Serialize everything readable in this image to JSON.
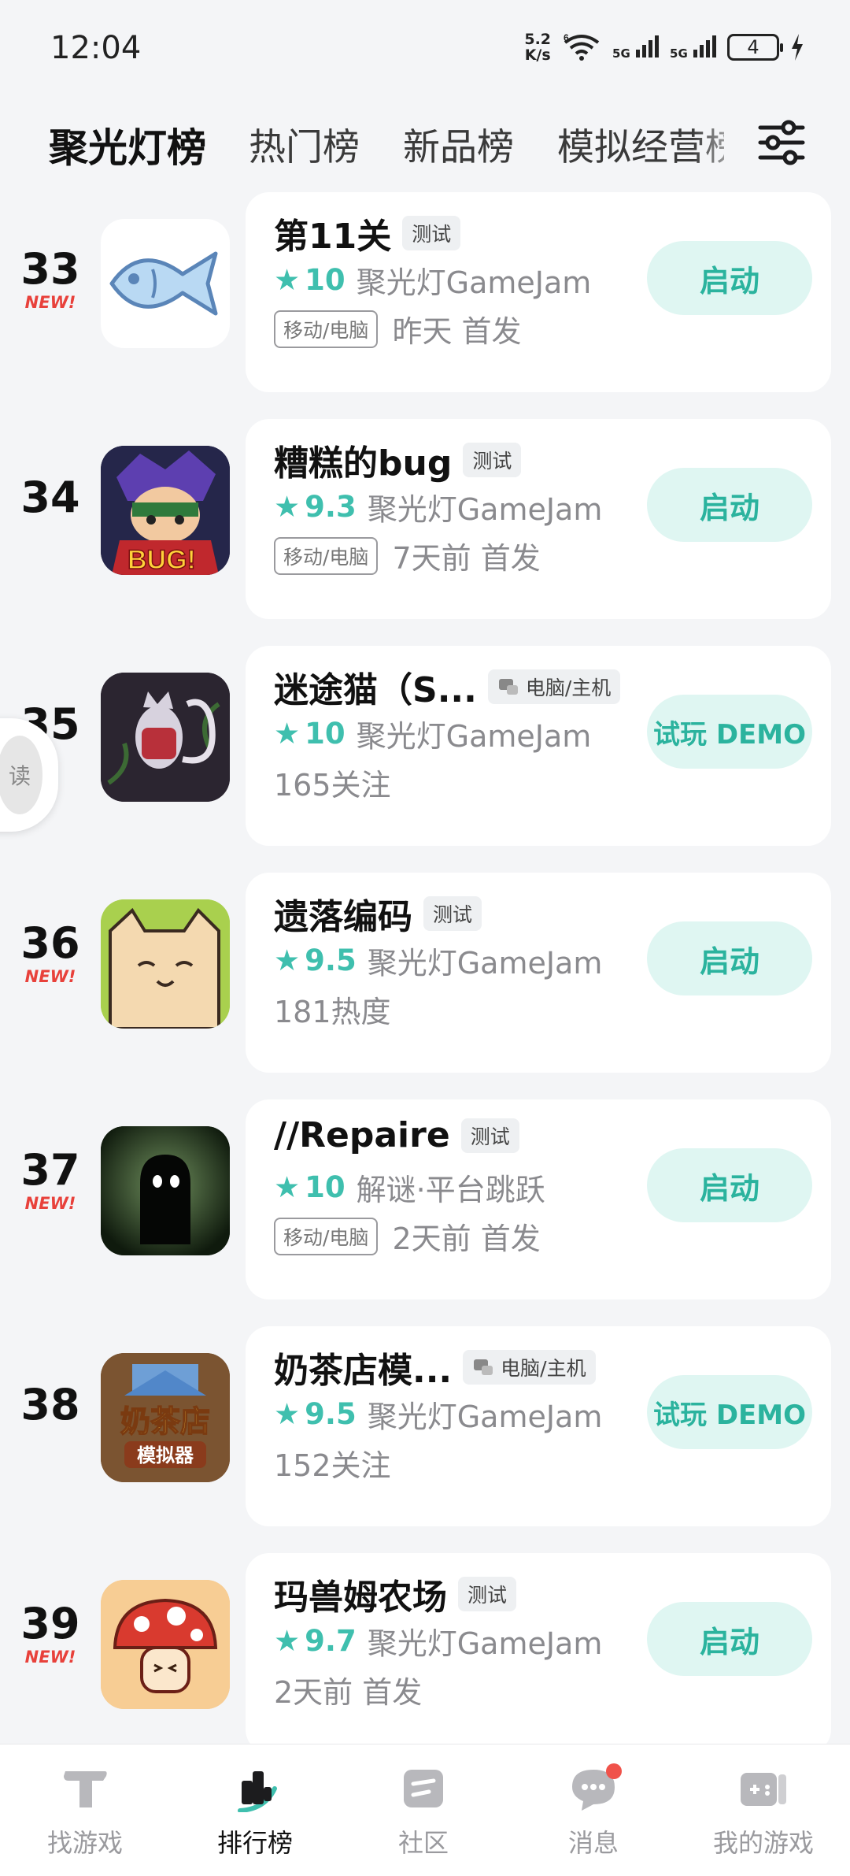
{
  "status_bar": {
    "time": "12:04",
    "net_speed_value": "5.2",
    "net_speed_unit": "K/s",
    "wifi_label": "6",
    "sim1": "5G",
    "sim2": "5G",
    "battery": "4"
  },
  "tabs": [
    {
      "label": "聚光灯榜",
      "active": true
    },
    {
      "label": "热门榜",
      "active": false
    },
    {
      "label": "新品榜",
      "active": false
    },
    {
      "label": "模拟经营榜",
      "active": false
    }
  ],
  "filter_icon": "sliders-icon",
  "games": [
    {
      "rank": "33",
      "new": "NEW!",
      "title": "第11关",
      "badge": "测试",
      "rating": "10",
      "category": "聚光灯GameJam",
      "platform": "移动/电脑",
      "meta": "昨天 首发",
      "action": "启动",
      "icon": "fish-icon"
    },
    {
      "rank": "34",
      "new": "",
      "title": "糟糕的bug",
      "badge": "测试",
      "rating": "9.3",
      "category": "聚光灯GameJam",
      "platform": "移动/电脑",
      "meta": "7天前 首发",
      "action": "启动",
      "icon": "bug-hero-icon"
    },
    {
      "rank": "35",
      "new": "",
      "title": "迷途猫（S...",
      "badge": "电脑/主机",
      "rating": "10",
      "category": "聚光灯GameJam",
      "platform": "",
      "meta": "165关注",
      "action": "试玩 DEMO",
      "icon": "lost-cat-icon"
    },
    {
      "rank": "36",
      "new": "NEW!",
      "title": "遗落编码",
      "badge": "测试",
      "rating": "9.5",
      "category": "聚光灯GameJam",
      "platform": "",
      "meta": "181热度",
      "action": "启动",
      "icon": "cat-face-icon"
    },
    {
      "rank": "37",
      "new": "NEW!",
      "title": "//Repaire",
      "badge": "测试",
      "rating": "10",
      "category": "解谜·平台跳跃",
      "platform": "移动/电脑",
      "meta": "2天前 首发",
      "action": "启动",
      "icon": "shadow-creature-icon"
    },
    {
      "rank": "38",
      "new": "",
      "title": "奶茶店模...",
      "badge": "电脑/主机",
      "rating": "9.5",
      "category": "聚光灯GameJam",
      "platform": "",
      "meta": "152关注",
      "action": "试玩 DEMO",
      "icon": "milk-tea-shop-icon",
      "icon_text_1": "奶茶店",
      "icon_text_2": "模拟器"
    },
    {
      "rank": "39",
      "new": "NEW!",
      "title": "玛兽姆农场",
      "badge": "测试",
      "rating": "9.7",
      "category": "聚光灯GameJam",
      "platform": "",
      "meta": "2天前 首发",
      "action": "启动",
      "icon": "mushroom-icon"
    }
  ],
  "float_widget": {
    "label": "读"
  },
  "bottom_nav": [
    {
      "label": "找游戏",
      "icon": "find-games-icon",
      "active": false
    },
    {
      "label": "排行榜",
      "icon": "ranking-icon",
      "active": true
    },
    {
      "label": "社区",
      "icon": "community-icon",
      "active": false
    },
    {
      "label": "消息",
      "icon": "message-icon",
      "active": false,
      "dot": true
    },
    {
      "label": "我的游戏",
      "icon": "my-games-icon",
      "active": false
    }
  ],
  "colors": {
    "accent": "#3fbfae",
    "accent_bg": "#dff6f2",
    "new_red": "#e8413b",
    "tab_underline": "#4fd1bf"
  }
}
